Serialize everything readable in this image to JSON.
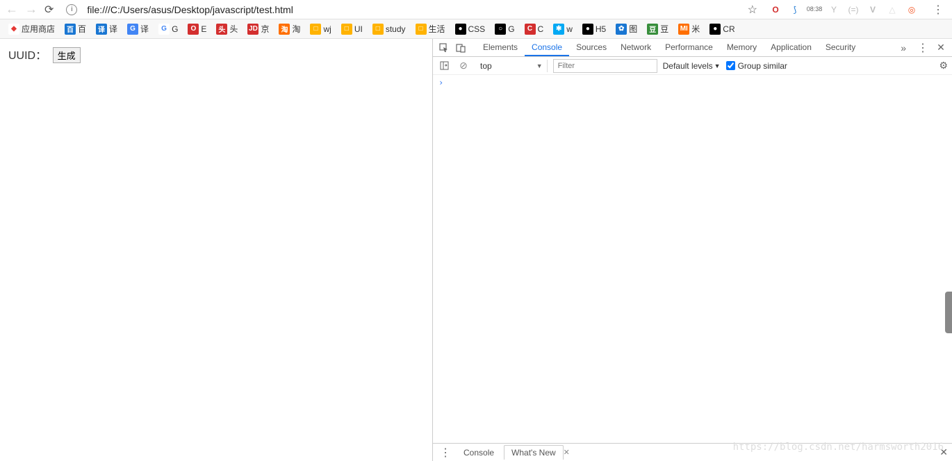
{
  "browser": {
    "url": "file:///C:/Users/asus/Desktop/javascript/test.html",
    "time": "08:38"
  },
  "bookmarks": [
    {
      "label": "应用商店",
      "bg": "#fff",
      "fg": "#e53935",
      "icon": "◆"
    },
    {
      "label": "百",
      "bg": "#1976d2",
      "fg": "#fff",
      "icon": "百"
    },
    {
      "label": "译",
      "bg": "#1976d2",
      "fg": "#fff",
      "icon": "译"
    },
    {
      "label": "译",
      "bg": "#4285f4",
      "fg": "#fff",
      "icon": "G"
    },
    {
      "label": "G",
      "bg": "#fff",
      "fg": "#4285f4",
      "icon": "G"
    },
    {
      "label": "E",
      "bg": "#d32f2f",
      "fg": "#fff",
      "icon": "O"
    },
    {
      "label": "头",
      "bg": "#d32f2f",
      "fg": "#fff",
      "icon": "头"
    },
    {
      "label": "京",
      "bg": "#d32f2f",
      "fg": "#fff",
      "icon": "JD"
    },
    {
      "label": "淘",
      "bg": "#ff6f00",
      "fg": "#fff",
      "icon": "淘"
    },
    {
      "label": "wj",
      "bg": "#ffb300",
      "fg": "#fff",
      "icon": "□"
    },
    {
      "label": "UI",
      "bg": "#ffb300",
      "fg": "#fff",
      "icon": "□"
    },
    {
      "label": "study",
      "bg": "#ffb300",
      "fg": "#fff",
      "icon": "□"
    },
    {
      "label": "生活",
      "bg": "#ffb300",
      "fg": "#fff",
      "icon": "□"
    },
    {
      "label": "CSS",
      "bg": "#000",
      "fg": "#fff",
      "icon": "●"
    },
    {
      "label": "G",
      "bg": "#000",
      "fg": "#fff",
      "icon": "○"
    },
    {
      "label": "C",
      "bg": "#d32f2f",
      "fg": "#fff",
      "icon": "C"
    },
    {
      "label": "w",
      "bg": "#03a9f4",
      "fg": "#fff",
      "icon": "✱"
    },
    {
      "label": "H5",
      "bg": "#000",
      "fg": "#fff",
      "icon": "●"
    },
    {
      "label": "图",
      "bg": "#1976d2",
      "fg": "#fff",
      "icon": "✿"
    },
    {
      "label": "豆",
      "bg": "#388e3c",
      "fg": "#fff",
      "icon": "豆"
    },
    {
      "label": "米",
      "bg": "#ff6f00",
      "fg": "#fff",
      "icon": "MI"
    },
    {
      "label": "CR",
      "bg": "#000",
      "fg": "#fff",
      "icon": "●"
    }
  ],
  "page": {
    "label": "UUID：",
    "button": "生成"
  },
  "devtools": {
    "tabs": [
      "Elements",
      "Console",
      "Sources",
      "Network",
      "Performance",
      "Memory",
      "Application",
      "Security"
    ],
    "active_tab": "Console",
    "context": "top",
    "filter_placeholder": "Filter",
    "levels": "Default levels",
    "group_similar": "Group similar",
    "prompt": "›",
    "drawer_tabs": [
      "Console",
      "What's New"
    ],
    "drawer_active": "What's New"
  },
  "watermark": "https://blog.csdn.net/harmsworth2016"
}
